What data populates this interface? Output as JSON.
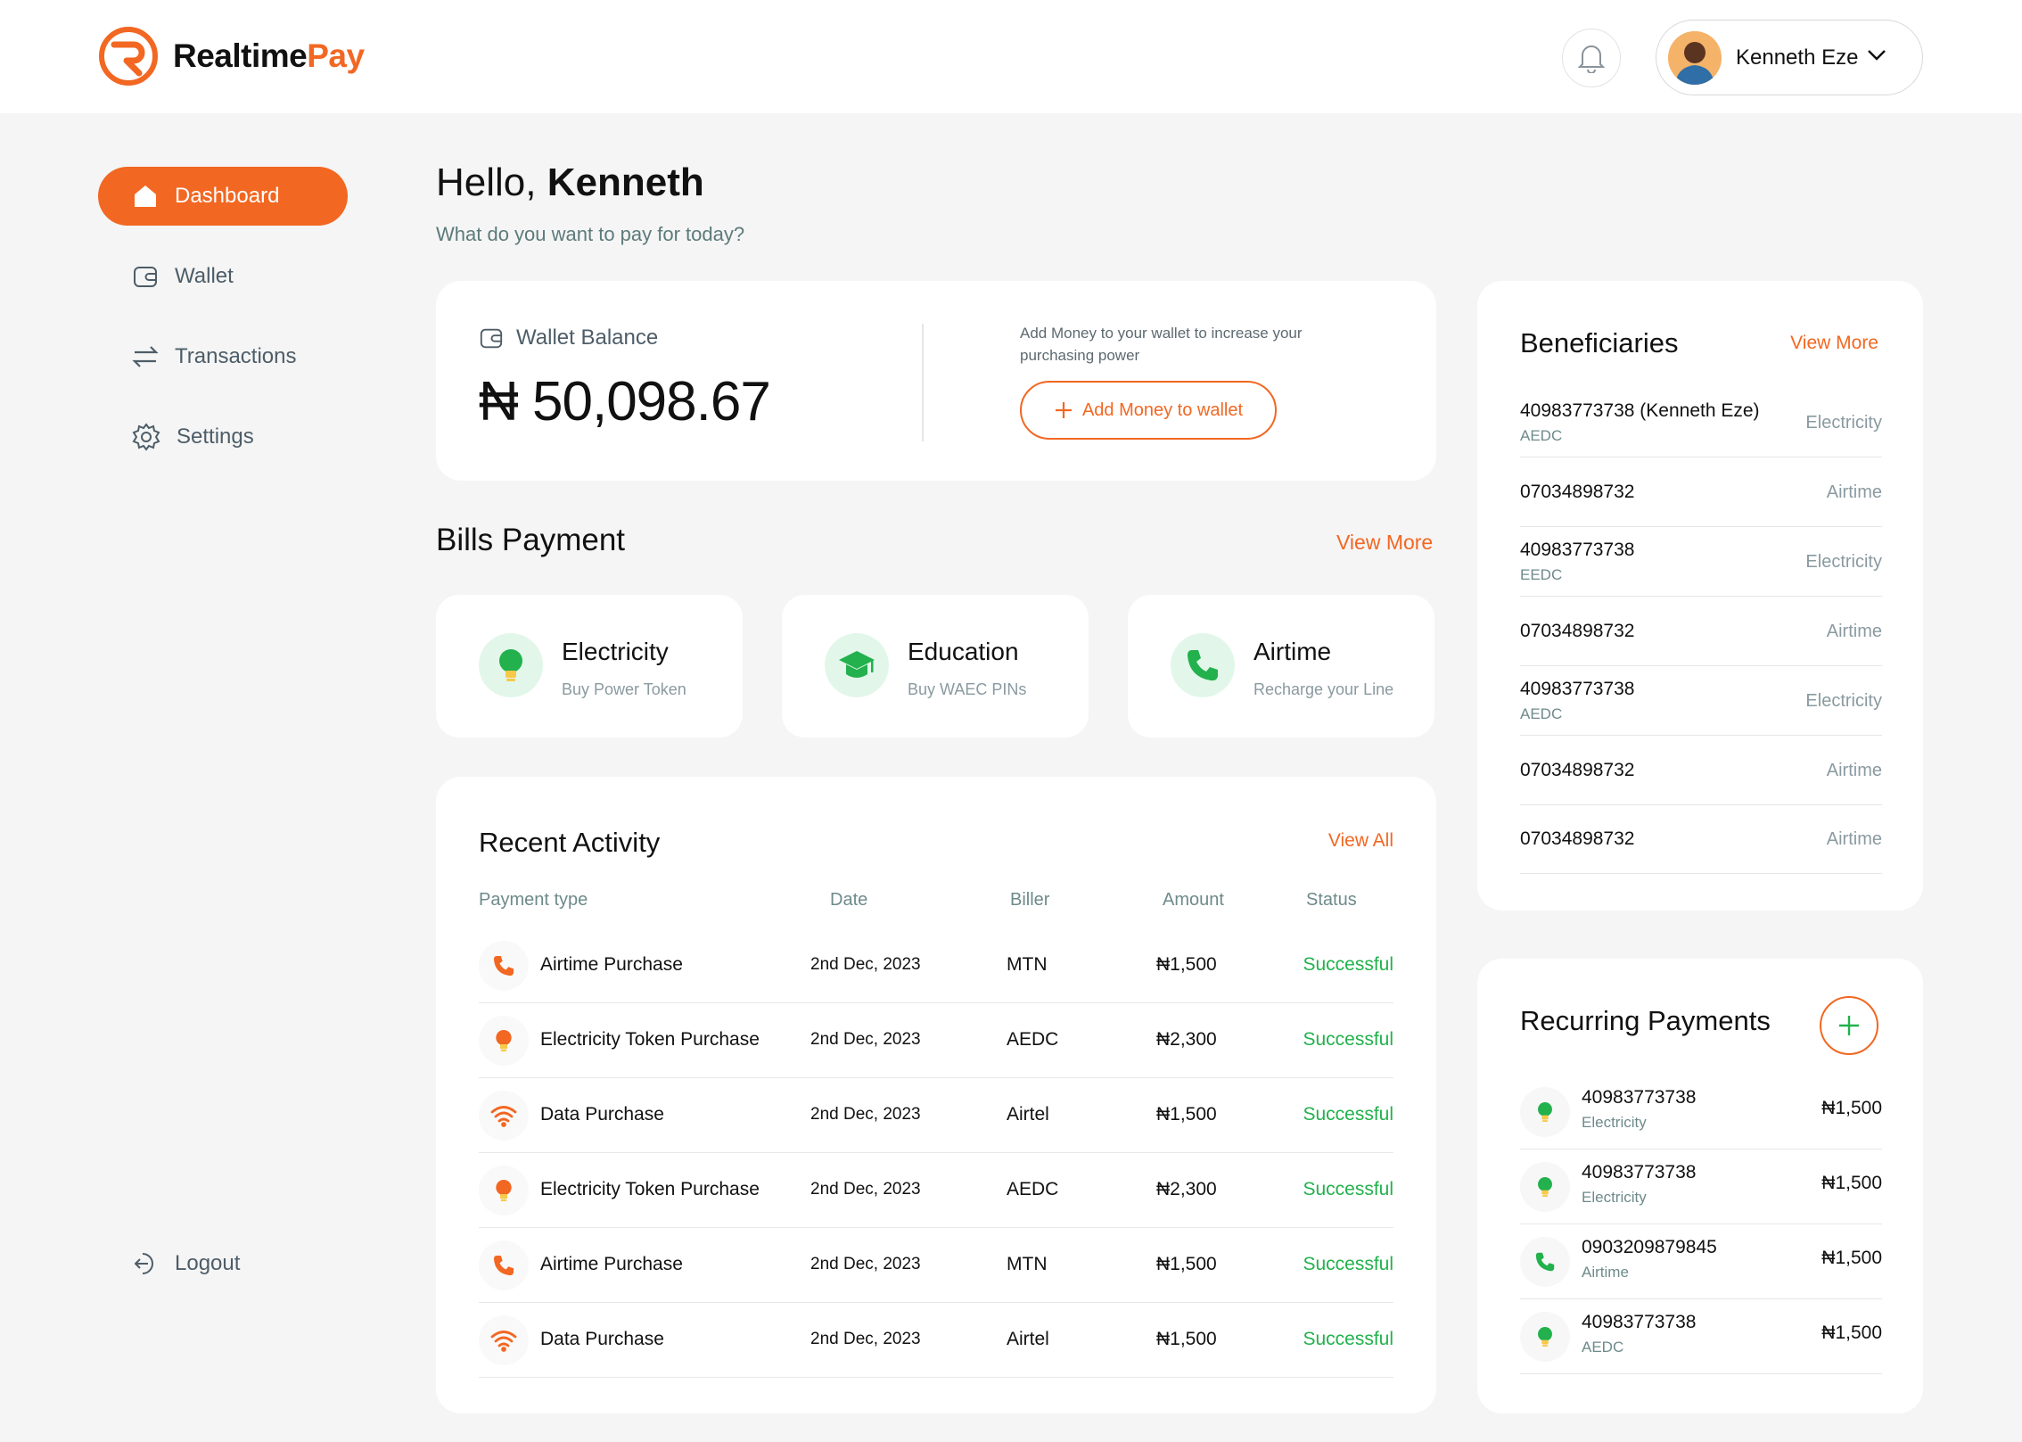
{
  "app": {
    "logo_text_a": "Realtime",
    "logo_text_b": "Pay",
    "accent": "#f26722",
    "success": "#22b14c"
  },
  "header": {
    "user_name": "Kenneth Eze"
  },
  "sidebar": {
    "items": [
      {
        "label": "Dashboard",
        "icon": "home-icon"
      },
      {
        "label": "Wallet",
        "icon": "wallet-icon"
      },
      {
        "label": "Transactions",
        "icon": "transfer-icon"
      },
      {
        "label": "Settings",
        "icon": "gear-icon"
      }
    ],
    "logout": "Logout"
  },
  "greeting": {
    "hello": "Hello,",
    "name": "Kenneth",
    "subtitle": "What do you want to pay for today?"
  },
  "wallet": {
    "label": "Wallet Balance",
    "balance": "₦ 50,098.67",
    "note": "Add Money to your wallet to increase your purchasing power",
    "add_button": "Add Money to wallet"
  },
  "bills": {
    "title": "Bills Payment",
    "view_more": "View More",
    "items": [
      {
        "title": "Electricity",
        "subtitle": "Buy Power Token",
        "icon": "lightbulb-icon"
      },
      {
        "title": "Education",
        "subtitle": "Buy WAEC PINs",
        "icon": "graduation-cap-icon"
      },
      {
        "title": "Airtime",
        "subtitle": "Recharge your Line",
        "icon": "phone-icon"
      }
    ]
  },
  "activity": {
    "title": "Recent Activity",
    "view_all": "View All",
    "columns": [
      "Payment type",
      "Date",
      "Biller",
      "Amount",
      "Status"
    ],
    "rows": [
      {
        "type": "Airtime Purchase",
        "date": "2nd Dec, 2023",
        "biller": "MTN",
        "amount": "₦1,500",
        "status": "Successful",
        "icon": "phone-icon"
      },
      {
        "type": "Electricity Token Purchase",
        "date": "2nd Dec, 2023",
        "biller": "AEDC",
        "amount": "₦2,300",
        "status": "Successful",
        "icon": "lightbulb-icon"
      },
      {
        "type": "Data Purchase",
        "date": "2nd Dec, 2023",
        "biller": "Airtel",
        "amount": "₦1,500",
        "status": "Successful",
        "icon": "wifi-icon"
      },
      {
        "type": "Electricity Token Purchase",
        "date": "2nd Dec, 2023",
        "biller": "AEDC",
        "amount": "₦2,300",
        "status": "Successful",
        "icon": "lightbulb-icon"
      },
      {
        "type": "Airtime Purchase",
        "date": "2nd Dec, 2023",
        "biller": "MTN",
        "amount": "₦1,500",
        "status": "Successful",
        "icon": "phone-icon"
      },
      {
        "type": "Data Purchase",
        "date": "2nd Dec, 2023",
        "biller": "Airtel",
        "amount": "₦1,500",
        "status": "Successful",
        "icon": "wifi-icon"
      }
    ]
  },
  "beneficiaries": {
    "title": "Beneficiaries",
    "view_more": "View More",
    "items": [
      {
        "number": "40983773738 (Kenneth Eze)",
        "sub": "AEDC",
        "type": "Electricity"
      },
      {
        "number": "07034898732",
        "sub": "",
        "type": "Airtime"
      },
      {
        "number": "40983773738",
        "sub": "EEDC",
        "type": "Electricity"
      },
      {
        "number": "07034898732",
        "sub": "",
        "type": "Airtime"
      },
      {
        "number": "40983773738",
        "sub": "AEDC",
        "type": "Electricity"
      },
      {
        "number": "07034898732",
        "sub": "",
        "type": "Airtime"
      },
      {
        "number": "07034898732",
        "sub": "",
        "type": "Airtime"
      }
    ]
  },
  "recurring": {
    "title": "Recurring Payments",
    "items": [
      {
        "number": "40983773738",
        "sub": "Electricity",
        "amount": "₦1,500",
        "icon": "lightbulb-icon"
      },
      {
        "number": "40983773738",
        "sub": "Electricity",
        "amount": "₦1,500",
        "icon": "lightbulb-icon"
      },
      {
        "number": "0903209879845",
        "sub": "Airtime",
        "amount": "₦1,500",
        "icon": "phone-icon"
      },
      {
        "number": "40983773738",
        "sub": "AEDC",
        "amount": "₦1,500",
        "icon": "lightbulb-icon"
      }
    ]
  }
}
